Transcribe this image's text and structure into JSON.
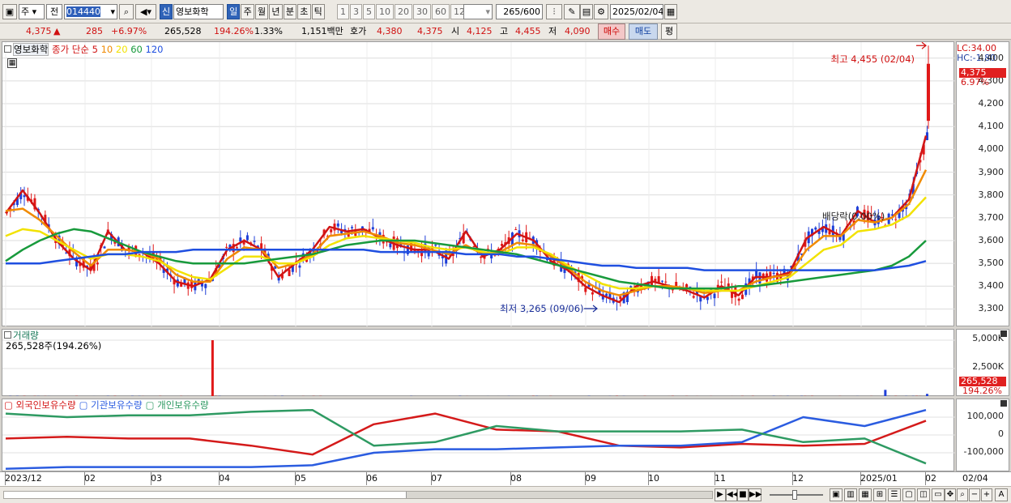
{
  "toolbar": {
    "type_label": "주",
    "prev_label": "전",
    "code_value": "014440",
    "credit_badge": "신",
    "stock_name": "영보화학",
    "periods": [
      "일",
      "주",
      "월",
      "년",
      "분",
      "초",
      "틱"
    ],
    "active_period": "일",
    "intervals": [
      "1",
      "3",
      "5",
      "10",
      "20",
      "30",
      "60",
      "120"
    ],
    "count_value": "265",
    "count_total": "/600",
    "date_value": "2025/02/04"
  },
  "quote": {
    "price": "4,375",
    "arrow": "▲",
    "change": "285",
    "change_pct": "+6.97%",
    "volume": "265,528",
    "volume_ratio": "194.26%",
    "turnover": "1.33%",
    "amount": "1,151백만",
    "bid_label": "호가",
    "bid1": "4,380",
    "bid2": "4,375",
    "open_label": "시",
    "open": "4,125",
    "high_label": "고",
    "high": "4,455",
    "low_label": "저",
    "low": "4,090",
    "buy_label": "매수",
    "sell_label": "매도",
    "avg_label": "평"
  },
  "legend": {
    "name": "영보화학",
    "close_label": "종가 단순",
    "ma": [
      {
        "period": "5",
        "color": "#d01414"
      },
      {
        "period": "10",
        "color": "#f08a00"
      },
      {
        "period": "20",
        "color": "#f2e200"
      },
      {
        "period": "60",
        "color": "#189a3c"
      },
      {
        "period": "120",
        "color": "#1f4fe0"
      }
    ]
  },
  "price_axis": {
    "lc": "LC:34.00",
    "hc": "HC:-1.80",
    "current": "4,375",
    "current_pct": "6.97%",
    "ticks": [
      "4,400",
      "4,300",
      "4,200",
      "4,100",
      "4,000",
      "3,900",
      "3,800",
      "3,700",
      "3,600",
      "3,500",
      "3,400",
      "3,300"
    ]
  },
  "annotations": {
    "high": "최고 4,455 (02/04)",
    "low": "최저 3,265 (09/06)",
    "dividend": "배당락(0.00%)"
  },
  "volume_panel": {
    "title": "거래량",
    "info": "265,528주(194.26%)",
    "ticks": [
      "5,000K",
      "2,500K"
    ],
    "current": "265,528",
    "current_pct": "194.26%"
  },
  "holdings_panel": {
    "series": [
      {
        "name": "외국인보유수량",
        "color": "#d41a1a"
      },
      {
        "name": "기관보유수량",
        "color": "#2b5ce0"
      },
      {
        "name": "개인보유수량",
        "color": "#2e9a62"
      }
    ],
    "ticks": [
      "100,000",
      "0",
      "-100,000"
    ]
  },
  "x_axis": {
    "labels": [
      "2023/12",
      "02",
      "03",
      "04",
      "05",
      "06",
      "07",
      "08",
      "09",
      "10",
      "11",
      "12",
      "2025/01",
      "02"
    ],
    "end_label": "02/04"
  },
  "chart_data": {
    "type": "line",
    "title": "영보화학",
    "price_range": [
      3220,
      4470
    ],
    "high": {
      "value": 4455,
      "date": "02/04"
    },
    "low": {
      "value": 3265,
      "date": "09/06"
    },
    "last_close": 4375,
    "series": [
      {
        "name": "5",
        "color": "#d01414",
        "values": [
          3720,
          3820,
          3720,
          3600,
          3520,
          3470,
          3640,
          3560,
          3550,
          3500,
          3420,
          3400,
          3430,
          3560,
          3600,
          3560,
          3440,
          3500,
          3560,
          3660,
          3640,
          3650,
          3610,
          3580,
          3560,
          3560,
          3520,
          3640,
          3530,
          3560,
          3630,
          3600,
          3510,
          3470,
          3400,
          3360,
          3330,
          3400,
          3420,
          3400,
          3380,
          3350,
          3400,
          3360,
          3440,
          3440,
          3460,
          3610,
          3660,
          3620,
          3730,
          3680,
          3700,
          3780,
          4060
        ]
      },
      {
        "name": "10",
        "color": "#f08a00",
        "values": [
          3730,
          3740,
          3690,
          3620,
          3550,
          3490,
          3560,
          3560,
          3550,
          3520,
          3450,
          3420,
          3420,
          3520,
          3570,
          3560,
          3480,
          3500,
          3540,
          3620,
          3630,
          3640,
          3620,
          3590,
          3580,
          3560,
          3540,
          3580,
          3540,
          3550,
          3590,
          3580,
          3530,
          3480,
          3420,
          3380,
          3360,
          3380,
          3400,
          3400,
          3390,
          3370,
          3380,
          3380,
          3420,
          3440,
          3450,
          3560,
          3620,
          3620,
          3690,
          3680,
          3700,
          3760,
          3910
        ]
      },
      {
        "name": "20",
        "color": "#f2e200",
        "values": [
          3620,
          3650,
          3640,
          3600,
          3560,
          3520,
          3540,
          3540,
          3530,
          3510,
          3470,
          3440,
          3430,
          3480,
          3530,
          3530,
          3500,
          3500,
          3530,
          3580,
          3610,
          3620,
          3610,
          3600,
          3590,
          3570,
          3560,
          3570,
          3550,
          3540,
          3570,
          3570,
          3540,
          3490,
          3450,
          3410,
          3390,
          3390,
          3400,
          3390,
          3390,
          3380,
          3380,
          3380,
          3400,
          3420,
          3440,
          3500,
          3560,
          3580,
          3640,
          3650,
          3670,
          3710,
          3790
        ]
      },
      {
        "name": "60",
        "color": "#189a3c",
        "values": [
          3510,
          3560,
          3600,
          3630,
          3650,
          3640,
          3610,
          3580,
          3550,
          3530,
          3510,
          3500,
          3500,
          3500,
          3500,
          3510,
          3520,
          3530,
          3540,
          3560,
          3580,
          3590,
          3600,
          3600,
          3600,
          3590,
          3580,
          3570,
          3560,
          3550,
          3540,
          3520,
          3500,
          3480,
          3460,
          3440,
          3420,
          3410,
          3400,
          3390,
          3390,
          3390,
          3390,
          3400,
          3400,
          3410,
          3420,
          3430,
          3440,
          3450,
          3460,
          3470,
          3490,
          3530,
          3600
        ]
      },
      {
        "name": "120",
        "color": "#1f4fe0",
        "values": [
          3500,
          3500,
          3500,
          3510,
          3520,
          3530,
          3540,
          3540,
          3550,
          3550,
          3550,
          3560,
          3560,
          3560,
          3560,
          3560,
          3560,
          3560,
          3560,
          3560,
          3560,
          3560,
          3550,
          3550,
          3550,
          3550,
          3550,
          3540,
          3540,
          3540,
          3530,
          3530,
          3520,
          3510,
          3500,
          3490,
          3490,
          3480,
          3480,
          3480,
          3480,
          3470,
          3470,
          3470,
          3470,
          3470,
          3470,
          3470,
          3470,
          3470,
          3470,
          3470,
          3480,
          3490,
          3510
        ]
      }
    ],
    "volume_spike": {
      "month": "04",
      "value_k": 5000
    },
    "holdings": [
      {
        "name": "외국인보유수량",
        "values": [
          -20000,
          -10000,
          -20000,
          -20000,
          -60000,
          -110000,
          60000,
          120000,
          30000,
          20000,
          -60000,
          -70000,
          -50000,
          -60000,
          -50000,
          80000
        ]
      },
      {
        "name": "기관보유수량",
        "values": [
          -190000,
          -180000,
          -180000,
          -180000,
          -180000,
          -170000,
          -100000,
          -80000,
          -80000,
          -70000,
          -60000,
          -60000,
          -40000,
          100000,
          50000,
          140000
        ]
      },
      {
        "name": "개인보유수량",
        "values": [
          120000,
          100000,
          110000,
          110000,
          130000,
          140000,
          -60000,
          -40000,
          50000,
          20000,
          20000,
          20000,
          30000,
          -40000,
          -20000,
          -160000
        ]
      }
    ]
  }
}
